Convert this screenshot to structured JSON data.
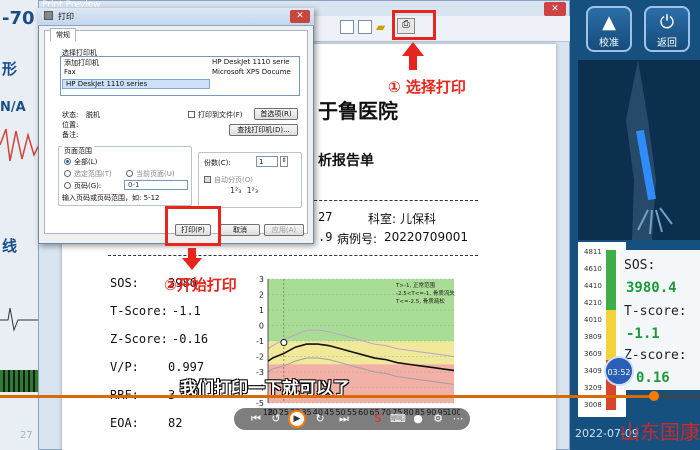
{
  "background_app": {
    "left_labels": [
      "-70",
      "形",
      "N/A",
      "线"
    ],
    "left_bottom_number": "27",
    "top_buttons": [
      {
        "label": "校准",
        "icon": "calibrate-icon"
      },
      {
        "label": "返回",
        "icon": "power-icon"
      }
    ],
    "right_panel": {
      "scale": [
        "4811",
        "4610",
        "4410",
        "4210",
        "4010",
        "3809",
        "3609",
        "3409",
        "3209",
        "3008"
      ],
      "sos_label": "SOS:",
      "sos_value": "3980.4",
      "tscore_label": "T-score:",
      "tscore_value": "-1.1",
      "zscore_label": "Z-score:",
      "zscore_value": "0.16",
      "date_partial": "2022-07-09"
    }
  },
  "print_preview": {
    "window_title": "Print Preview",
    "report": {
      "hospital_partial": "于鲁医院",
      "subtitle_partial": "析报告单",
      "row1_partial": "27",
      "dept_label": "科室:",
      "dept_value": "儿保科",
      "row2_partial": ".9",
      "case_label": "病例号:",
      "case_value": "20220709001",
      "sos_label": "SOS:",
      "sos_value": "3980",
      "tscore_label": "T-Score:",
      "tscore_value": "-1.1",
      "zscore_label": "Z-Score:",
      "zscore_value": "-0.16",
      "vp_label": "V/P:",
      "vp_value": "0.997",
      "rrf_label": "RRF:",
      "rrf_value": "3",
      "eoa_label": "EOA:",
      "eoa_value": "82"
    }
  },
  "print_dialog": {
    "title": "打印",
    "tab": "常规",
    "select_printer_label": "选择打印机",
    "printers": [
      "添加打印机",
      "HP DeskJet 1110 serie",
      "Fax",
      "Microsoft XPS Docume",
      "HP DeskJet 1110 series"
    ],
    "status_label": "状态:",
    "status_value": "脱机",
    "location_label": "位置:",
    "comment_label": "备注:",
    "print_to_file": "打印到文件(F)",
    "preferences_btn": "首选项(R)",
    "find_printer_btn": "查找打印机(D)...",
    "page_range_label": "页面范围",
    "all_option": "全部(L)",
    "selection_option": "选定范围(T)",
    "current_page_option": "当前页面(U)",
    "pages_option": "页码(G):",
    "pages_value": "0-1",
    "pages_hint": "输入页码或页码范围，如: 5-12",
    "copies_label": "份数(C):",
    "copies_value": "1",
    "collate_label": "自动分页(O)",
    "print_btn": "打印(P)",
    "cancel_btn": "取消",
    "apply_btn": "应用(A)"
  },
  "annotations": {
    "step1": "① 选择打印",
    "step2": "②开始打印"
  },
  "video": {
    "subtitle": "我们打印一下就可以了",
    "time": "03:52",
    "watermark": "山东国康",
    "progress": 0.935
  },
  "chart_data": {
    "type": "line",
    "title": "",
    "legend": [
      "T>-1, 正常范围",
      "-2.5<T<=-1, 骨质流失",
      "T<=-2.5, 骨质疏松"
    ],
    "x": [
      18,
      20,
      25,
      30,
      35,
      40,
      45,
      50,
      55,
      60,
      65,
      70,
      75,
      80,
      85,
      90,
      95,
      100
    ],
    "ylim": [
      -5,
      3
    ],
    "yticks": [
      3,
      2,
      1,
      0,
      -1,
      -2,
      -3,
      -4,
      -5
    ],
    "series": [
      {
        "values": [
          -1.5,
          -1.3,
          -0.9,
          -0.6,
          -0.3,
          -0.3,
          -0.4,
          -0.6,
          -0.8,
          -1.0,
          -1.2,
          -1.3,
          -1.5,
          -1.6,
          -1.7,
          -1.8,
          -1.9,
          -2.0
        ]
      },
      {
        "values": [
          -2.3,
          -2.1,
          -1.8,
          -1.4,
          -1.2,
          -1.2,
          -1.3,
          -1.5,
          -1.7,
          -1.9,
          -2.1,
          -2.2,
          -2.4,
          -2.5,
          -2.6,
          -2.7,
          -2.8,
          -2.9
        ]
      },
      {
        "values": [
          -3.0,
          -2.8,
          -2.6,
          -2.3,
          -2.1,
          -2.1,
          -2.2,
          -2.4,
          -2.6,
          -2.8,
          -3.0,
          -3.1,
          -3.3,
          -3.4,
          -3.5,
          -3.6,
          -3.7,
          -3.8
        ]
      }
    ],
    "point": {
      "x": 25,
      "y": -1.1
    },
    "bands": [
      {
        "from": -1,
        "to": 3,
        "color": "#a9dc94"
      },
      {
        "from": -2.5,
        "to": -1,
        "color": "#f1e99a"
      },
      {
        "from": -5,
        "to": -2.5,
        "color": "#f2b0a6"
      }
    ]
  }
}
